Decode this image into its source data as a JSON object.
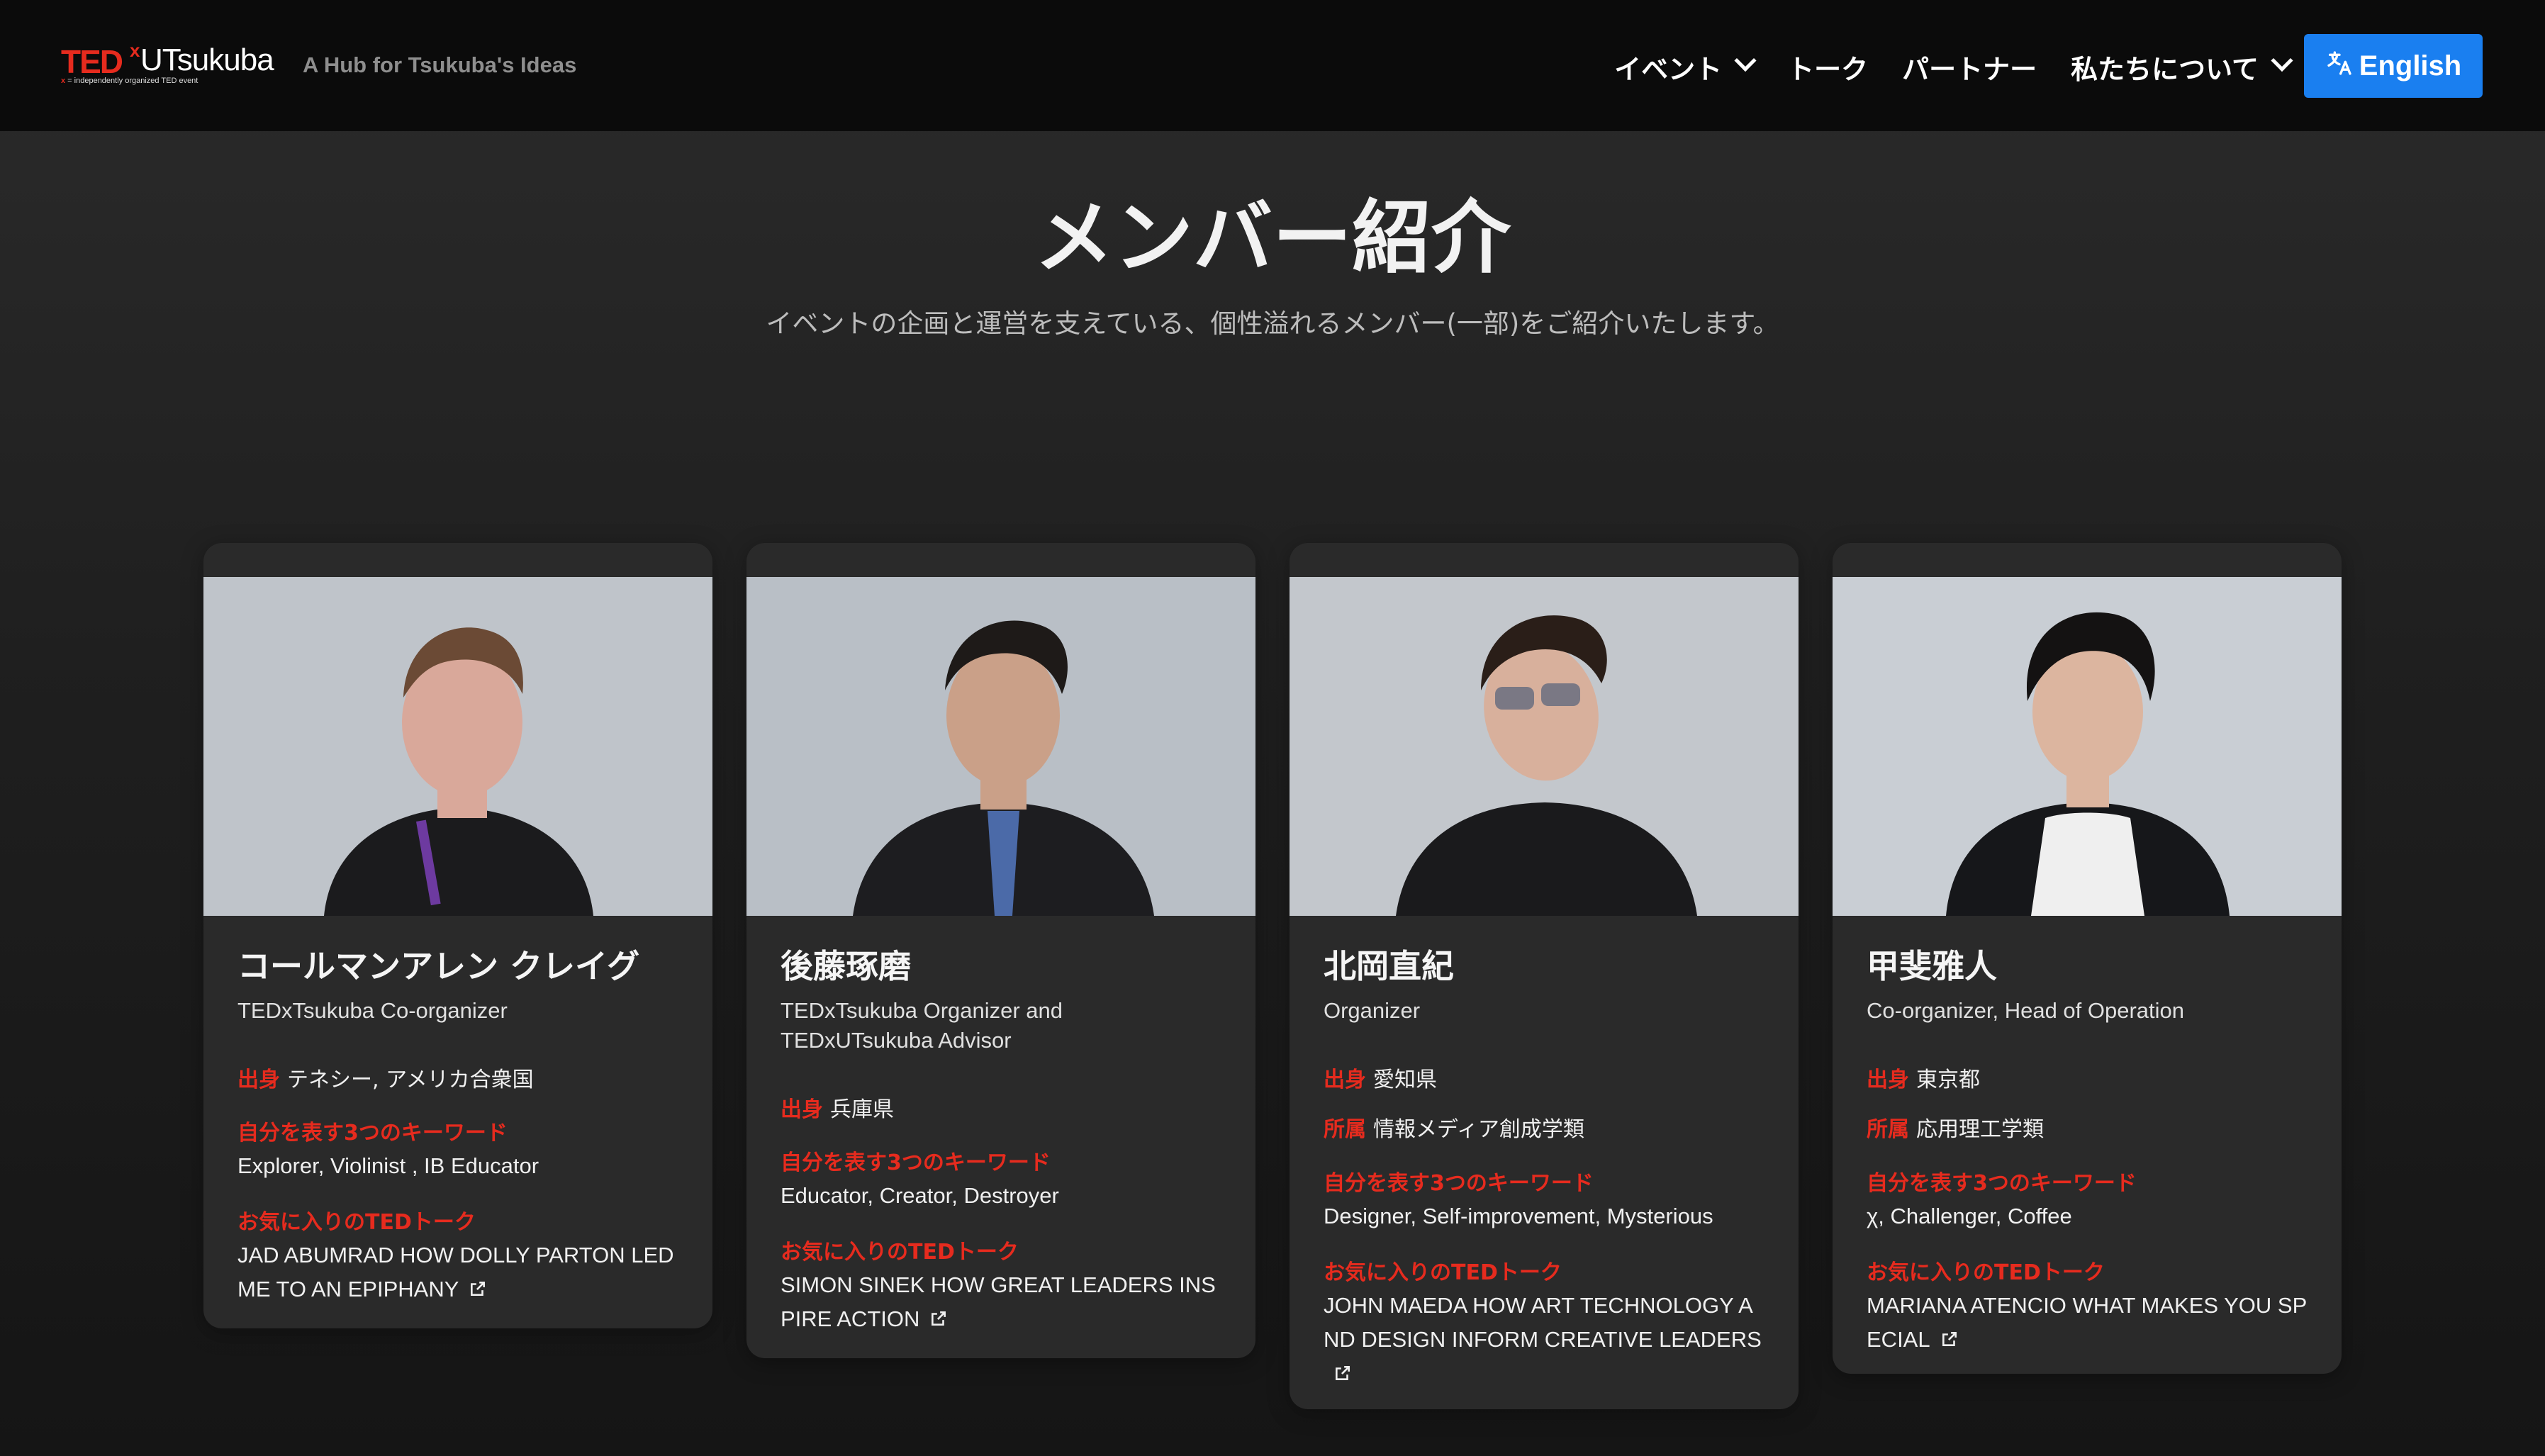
{
  "header": {
    "logo_ted": "TED",
    "logo_x": "x",
    "logo_event": "UTsukuba",
    "logo_sub_x": "x",
    "logo_sub": " = independently organized TED event",
    "tagline": "A Hub for Tsukuba's Ideas",
    "nav": [
      {
        "label": "イベント",
        "has_dropdown": true
      },
      {
        "label": "トーク",
        "has_dropdown": false
      },
      {
        "label": "パートナー",
        "has_dropdown": false
      },
      {
        "label": "私たちについて",
        "has_dropdown": true
      }
    ],
    "language_button": {
      "icon": "translate-icon",
      "label": "English"
    }
  },
  "hero": {
    "title": "メンバー紹介",
    "subtitle": "イベントの企画と運営を支えている、個性溢れるメンバー(一部)をご紹介いたします。"
  },
  "labels": {
    "origin": "出身",
    "affiliation": "所属",
    "keywords": "自分を表す3つのキーワード",
    "favorite_talk": "お気に入りのTEDトーク"
  },
  "members": [
    {
      "name": "コールマンアレン クレイグ",
      "role": "TEDxTsukuba Co-organizer",
      "origin": "テネシー, アメリカ合衆国",
      "keywords": "Explorer, Violinist , IB Educator",
      "favorite_talk": "JAD ABUMRAD HOW DOLLY PARTON LED ME TO AN EPIPHANY"
    },
    {
      "name": "後藤琢磨",
      "role": "TEDxTsukuba Organizer and\nTEDxUTsukuba Advisor",
      "origin": "兵庫県",
      "keywords": "Educator, Creator, Destroyer",
      "favorite_talk": "SIMON SINEK HOW GREAT LEADERS INSPIRE ACTION"
    },
    {
      "name": "北岡直紀",
      "role": "Organizer",
      "origin": "愛知県",
      "affiliation": "情報メディア創成学類",
      "keywords": "Designer, Self-improvement, Mysterious",
      "favorite_talk": "JOHN MAEDA HOW ART TECHNOLOGY AND DESIGN INFORM CREATIVE LEADERS"
    },
    {
      "name": "甲斐雅人",
      "role": "Co-organizer, Head of Operation",
      "origin": "東京都",
      "affiliation": "応用理工学類",
      "keywords": "χ, Challenger, Coffee",
      "favorite_talk": "MARIANA ATENCIO WHAT MAKES YOU SPECIAL"
    }
  ],
  "colors": {
    "accent_red": "#e62b1e",
    "button_blue": "#1a7ff0",
    "header_bg": "#0b0b0b",
    "card_bg": "#2a2a2a"
  }
}
